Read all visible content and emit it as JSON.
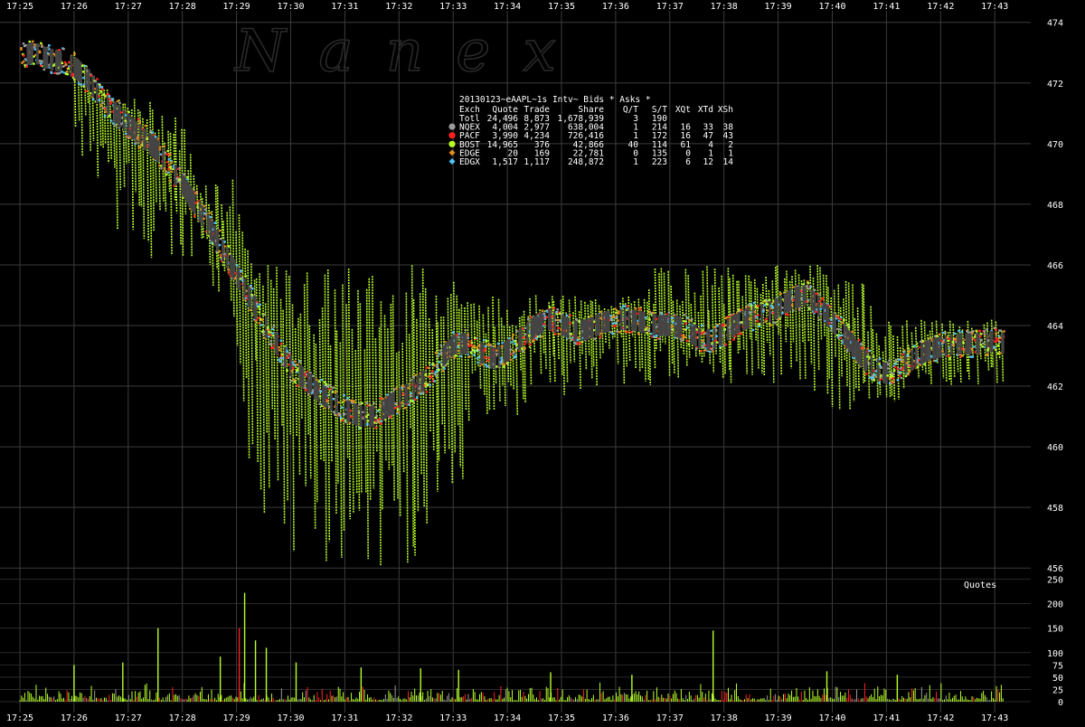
{
  "watermark": "N a n e x",
  "volume_label": "Quotes",
  "chart_data": {
    "type": "scatter",
    "title": "20130123~eAAPL~1s Intv~ Bids * Asks *",
    "x_ticks": [
      "17:25",
      "17:26",
      "17:27",
      "17:28",
      "17:29",
      "17:30",
      "17:31",
      "17:32",
      "17:33",
      "17:34",
      "17:35",
      "17:36",
      "17:37",
      "17:38",
      "17:39",
      "17:40",
      "17:41",
      "17:42",
      "17:43"
    ],
    "price_axis": {
      "ylim": [
        455.5,
        474.2
      ],
      "ticks": [
        456,
        458,
        460,
        462,
        464,
        466,
        468,
        470,
        472,
        474
      ]
    },
    "volume_axis": {
      "ylim": [
        0,
        260
      ],
      "ticks": [
        0,
        25,
        50,
        75,
        100,
        150,
        200,
        250
      ]
    },
    "grid": true,
    "legend": {
      "placement": "top-center",
      "headers": [
        "Exch",
        "Quote",
        "Trade",
        "Share",
        "Q/T",
        "S/T",
        "XQt",
        "XTd",
        "XSh"
      ],
      "rows": [
        {
          "exch": "Totl",
          "quote": "24,496",
          "trade": "8,873",
          "share": "1,678,939",
          "qt": "3",
          "st": "190",
          "xqt": "",
          "xtd": "",
          "xsh": "",
          "color": ""
        },
        {
          "exch": "NQEX",
          "quote": "4,004",
          "trade": "2,977",
          "share": "638,004",
          "qt": "1",
          "st": "214",
          "xqt": "16",
          "xtd": "33",
          "xsh": "38",
          "color": "#9a9a9a"
        },
        {
          "exch": "PACF",
          "quote": "3,990",
          "trade": "4,234",
          "share": "726,416",
          "qt": "1",
          "st": "172",
          "xqt": "16",
          "xtd": "47",
          "xsh": "43",
          "color": "#ff2020"
        },
        {
          "exch": "BOST",
          "quote": "14,965",
          "trade": "376",
          "share": "42,866",
          "qt": "40",
          "st": "114",
          "xqt": "61",
          "xtd": "4",
          "xsh": "2",
          "color": "#b8ff2a"
        },
        {
          "exch": "EDGE",
          "quote": "20",
          "trade": "169",
          "share": "22,781",
          "qt": "0",
          "st": "135",
          "xqt": "0",
          "xtd": "1",
          "xsh": "1",
          "color": "#e08a20"
        },
        {
          "exch": "EDGX",
          "quote": "1,517",
          "trade": "1,117",
          "share": "248,872",
          "qt": "1",
          "st": "223",
          "xqt": "6",
          "xtd": "12",
          "xsh": "14",
          "color": "#4fc3f7"
        }
      ]
    },
    "series": [
      {
        "name": "NQEX",
        "color": "#9a9a9a"
      },
      {
        "name": "PACF",
        "color": "#ff2020"
      },
      {
        "name": "BOST",
        "color": "#b8ff2a"
      },
      {
        "name": "EDGE",
        "color": "#e08a20"
      },
      {
        "name": "EDGX",
        "color": "#4fc3f7"
      }
    ],
    "bid_ask_trace": {
      "minutes": [
        0,
        0.25,
        0.5,
        0.75,
        1,
        1.25,
        1.5,
        1.75,
        2,
        2.25,
        2.5,
        2.75,
        3,
        3.25,
        3.5,
        3.75,
        4,
        4.25,
        4.5,
        4.75,
        5,
        5.25,
        5.5,
        5.75,
        6,
        6.25,
        6.5,
        6.75,
        7,
        7.25,
        7.5,
        7.75,
        8,
        8.25,
        8.5,
        8.75,
        9,
        9.25,
        9.5,
        9.75,
        10,
        10.25,
        10.5,
        10.75,
        11,
        11.25,
        11.5,
        11.75,
        12,
        12.25,
        12.5,
        12.75,
        13,
        13.25,
        13.5,
        13.75,
        14,
        14.25,
        14.5,
        14.75,
        15,
        15.25,
        15.5,
        15.75,
        16,
        16.25,
        16.5,
        16.75,
        17,
        17.25,
        17.5,
        17.75,
        18,
        18.15
      ],
      "mid": [
        472.9,
        473.0,
        472.8,
        472.7,
        472.5,
        472.1,
        471.4,
        471.0,
        470.6,
        470.2,
        469.8,
        469.2,
        468.6,
        467.9,
        467.2,
        466.4,
        465.6,
        464.8,
        464.0,
        463.3,
        462.6,
        462.2,
        461.8,
        461.5,
        461.2,
        461.0,
        461.0,
        461.3,
        461.6,
        461.9,
        462.3,
        462.9,
        463.4,
        463.4,
        463.1,
        462.9,
        463.2,
        463.6,
        464.0,
        464.2,
        464.0,
        463.8,
        463.9,
        464.1,
        464.2,
        464.2,
        464.1,
        464.0,
        464.0,
        463.9,
        463.6,
        463.5,
        463.8,
        464.1,
        464.3,
        464.4,
        464.6,
        464.9,
        465.0,
        464.6,
        464.1,
        463.6,
        463.0,
        462.6,
        462.4,
        462.7,
        462.9,
        463.2,
        463.3,
        463.4,
        463.4,
        463.4,
        463.5,
        463.4
      ]
    },
    "bost_spikes": {
      "description": "BOST quotes sweeping far away from the inside market",
      "upper_envelope": [
        473.3,
        473.3,
        473.3,
        473.3,
        473.3,
        472.6,
        472.0,
        471.5,
        471.5,
        471.5,
        471.3,
        471.0,
        471.0,
        469.0,
        469.0,
        469.0,
        469.0,
        466.0,
        466.0,
        466.0,
        466.0,
        466.0,
        466.0,
        466.0,
        466.0,
        466.0,
        466.0,
        466.0,
        466.0,
        466.0,
        466.0,
        466.0,
        466.0,
        465.0,
        465.0,
        465.0,
        465.0,
        465.0,
        465.0,
        465.0,
        465.0,
        465.0,
        465.0,
        465.0,
        465.0,
        465.0,
        465.0,
        466.0,
        466.0,
        466.0,
        466.0,
        466.0,
        466.0,
        466.0,
        466.0,
        466.0,
        466.0,
        466.0,
        466.0,
        466.0,
        466.0,
        466.0,
        466.0,
        464.5,
        464.2,
        464.2,
        464.2,
        464.2,
        464.2,
        464.2,
        464.2,
        464.2,
        464.2,
        464.2
      ],
      "lower_envelope": [
        472.5,
        472.5,
        472.3,
        471.0,
        469.5,
        469.0,
        468.5,
        467.0,
        466.0,
        466.0,
        466.0,
        466.0,
        466.0,
        466.0,
        465.0,
        464.0,
        463.0,
        458.0,
        457.0,
        456.0,
        456.0,
        456.0,
        456.0,
        456.0,
        456.0,
        456.0,
        456.0,
        456.0,
        456.0,
        456.0,
        456.0,
        456.0,
        456.0,
        460.0,
        460.5,
        461.0,
        461.0,
        461.0,
        461.5,
        461.5,
        461.5,
        461.5,
        462.0,
        462.0,
        462.0,
        462.0,
        462.0,
        462.0,
        462.0,
        462.0,
        462.0,
        462.0,
        462.0,
        462.0,
        462.0,
        462.0,
        462.0,
        461.5,
        461.0,
        461.0,
        461.0,
        461.0,
        461.5,
        461.5,
        461.5,
        461.5,
        462.0,
        462.0,
        462.0,
        462.0,
        462.0,
        462.0,
        462.0,
        462.0
      ]
    },
    "volume_spikes": [
      {
        "minute": 4.15,
        "value": 222,
        "color": "#b8ff2a"
      },
      {
        "minute": 4.05,
        "value": 150,
        "color": "#ff2020"
      },
      {
        "minute": 2.55,
        "value": 150,
        "color": "#b8ff2a"
      },
      {
        "minute": 12.8,
        "value": 145,
        "color": "#b8ff2a"
      },
      {
        "minute": 4.35,
        "value": 125,
        "color": "#b8ff2a"
      },
      {
        "minute": 4.55,
        "value": 110,
        "color": "#b8ff2a"
      },
      {
        "minute": 1.0,
        "value": 75,
        "color": "#b8ff2a"
      },
      {
        "minute": 1.9,
        "value": 80,
        "color": "#b8ff2a"
      },
      {
        "minute": 3.7,
        "value": 92,
        "color": "#b8ff2a"
      },
      {
        "minute": 5.1,
        "value": 80,
        "color": "#b8ff2a"
      },
      {
        "minute": 6.3,
        "value": 70,
        "color": "#b8ff2a"
      },
      {
        "minute": 7.4,
        "value": 68,
        "color": "#b8ff2a"
      },
      {
        "minute": 8.1,
        "value": 65,
        "color": "#b8ff2a"
      },
      {
        "minute": 9.8,
        "value": 60,
        "color": "#b8ff2a"
      },
      {
        "minute": 11.3,
        "value": 55,
        "color": "#b8ff2a"
      },
      {
        "minute": 14.9,
        "value": 62,
        "color": "#b8ff2a"
      },
      {
        "minute": 16.2,
        "value": 55,
        "color": "#b8ff2a"
      }
    ]
  }
}
